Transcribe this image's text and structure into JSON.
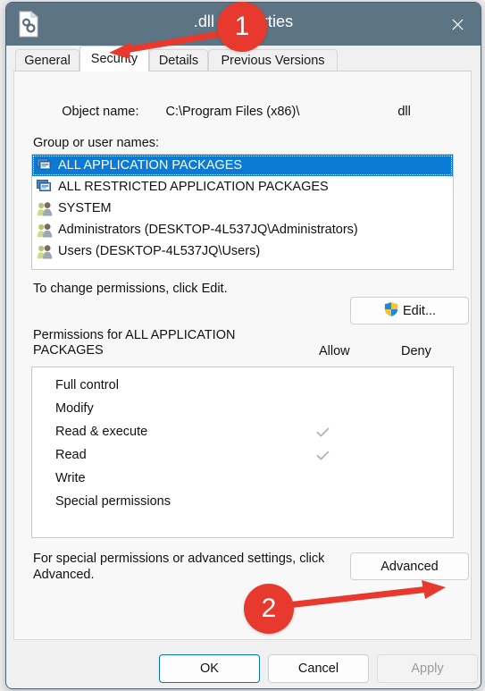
{
  "window": {
    "title": ".dll Properties",
    "icon": "dll-file-icon",
    "close_label": "Close",
    "titlebar_color": "#5d7484"
  },
  "tabs": [
    {
      "label": "General",
      "active": false
    },
    {
      "label": "Security",
      "active": true
    },
    {
      "label": "Details",
      "active": false
    },
    {
      "label": "Previous Versions",
      "active": false
    }
  ],
  "security": {
    "object_name_label": "Object name:",
    "object_name_path": "C:\\Program Files (x86)\\",
    "object_name_ext": "dll",
    "group_label": "Group or user names:",
    "principals": [
      {
        "name": "ALL APPLICATION PACKAGES",
        "icon": "package-icon",
        "selected": true
      },
      {
        "name": "ALL RESTRICTED APPLICATION PACKAGES",
        "icon": "package-icon",
        "selected": false
      },
      {
        "name": "SYSTEM",
        "icon": "user-group-icon",
        "selected": false
      },
      {
        "name": "Administrators (DESKTOP-4L537JQ\\Administrators)",
        "icon": "user-group-icon",
        "selected": false
      },
      {
        "name": "Users (DESKTOP-4L537JQ\\Users)",
        "icon": "user-group-icon",
        "selected": false
      }
    ],
    "change_hint": "To change permissions, click Edit.",
    "edit_button": "Edit...",
    "permissions_label": "Permissions for ALL APPLICATION PACKAGES",
    "column_allow": "Allow",
    "column_deny": "Deny",
    "permissions": [
      {
        "name": "Full control",
        "allow": false,
        "deny": false
      },
      {
        "name": "Modify",
        "allow": false,
        "deny": false
      },
      {
        "name": "Read & execute",
        "allow": true,
        "deny": false
      },
      {
        "name": "Read",
        "allow": true,
        "deny": false
      },
      {
        "name": "Write",
        "allow": false,
        "deny": false
      },
      {
        "name": "Special permissions",
        "allow": false,
        "deny": false
      }
    ],
    "advanced_hint": "For special permissions or advanced settings, click Advanced.",
    "advanced_button": "Advanced"
  },
  "footer": {
    "ok": "OK",
    "cancel": "Cancel",
    "apply": "Apply",
    "apply_disabled": true
  },
  "annotations": {
    "badge1": "1",
    "badge2": "2",
    "accent_color": "#e8392f"
  }
}
